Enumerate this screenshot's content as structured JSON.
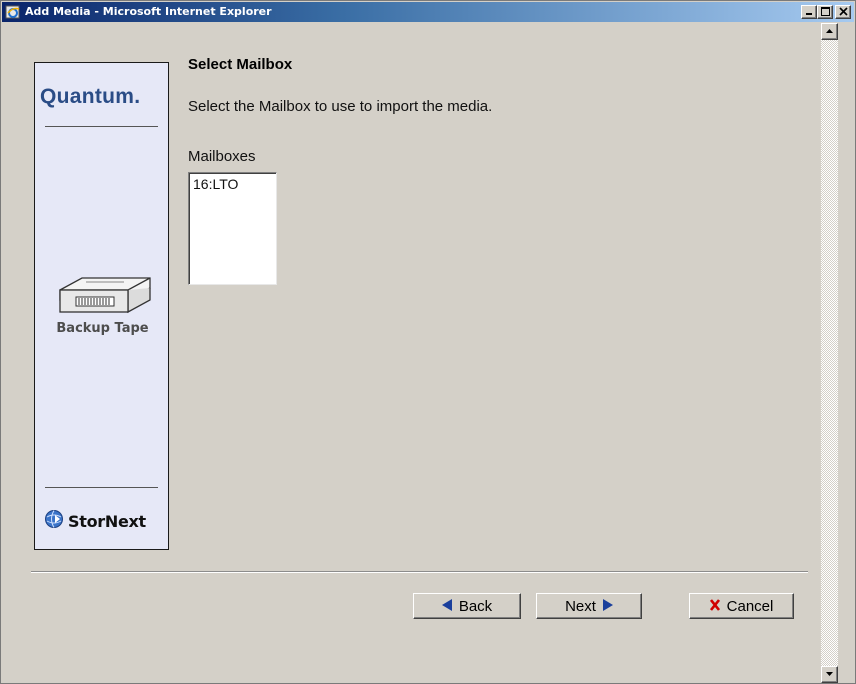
{
  "window": {
    "title": "Add Media - Microsoft Internet Explorer",
    "min_label": "_",
    "max_label": "□",
    "close_label": "✕"
  },
  "brand": {
    "logo_text": "Quantum.",
    "media_label": "Backup Tape",
    "product_text": "StorNext"
  },
  "main": {
    "heading": "Select Mailbox",
    "instruction": "Select the Mailbox to use to import the media.",
    "list_label": "Mailboxes",
    "mailboxes": [
      "16:LTO"
    ]
  },
  "buttons": {
    "back": "Back",
    "next": "Next",
    "cancel": "Cancel"
  },
  "colors": {
    "title_bar": "#0a246a",
    "brand_blue": "#2a4c86",
    "cancel_x": "#d00000",
    "arrow_blue": "#1a3f9c"
  }
}
